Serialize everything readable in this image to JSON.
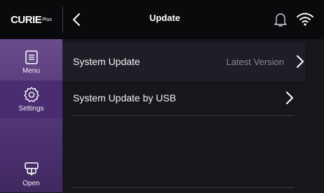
{
  "header": {
    "logo_main": "CURIE",
    "logo_sup": "Plus",
    "title": "Update"
  },
  "sidebar": {
    "items": [
      {
        "label": "Menu",
        "icon": "menu-icon"
      },
      {
        "label": "Settings",
        "icon": "gear-icon",
        "active": true
      },
      {
        "label": "Open",
        "icon": "open-tray-icon"
      }
    ]
  },
  "content": {
    "rows": [
      {
        "label": "System Update",
        "value": "Latest Version"
      },
      {
        "label": "System Update by USB",
        "value": ""
      }
    ]
  },
  "colors": {
    "accent": "#6a4c8e",
    "background": "#16161d",
    "topbar": "#0a0a0d"
  }
}
